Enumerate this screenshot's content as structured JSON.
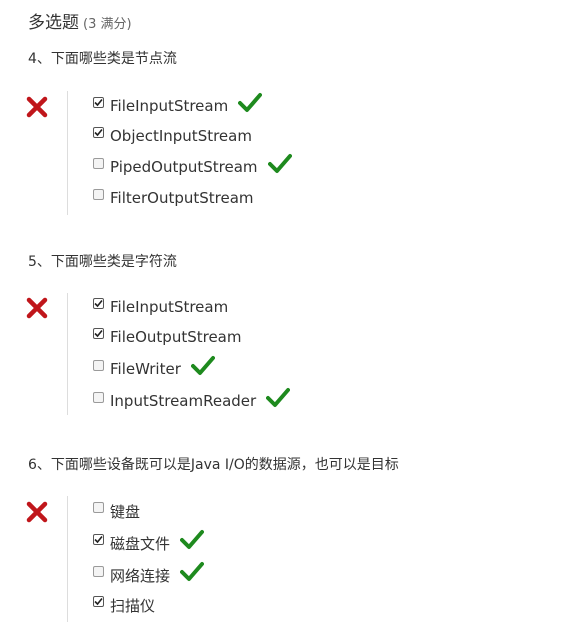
{
  "header": {
    "title": "多选题",
    "score": "(3 满分)"
  },
  "questions": [
    {
      "title": "4、下面哪些类是节点流",
      "options": [
        {
          "label": "FileInputStream",
          "checked": true,
          "correct": true
        },
        {
          "label": "ObjectInputStream",
          "checked": true,
          "correct": false
        },
        {
          "label": "PipedOutputStream",
          "checked": false,
          "correct": true
        },
        {
          "label": "FilterOutputStream",
          "checked": false,
          "correct": false
        }
      ]
    },
    {
      "title": "5、下面哪些类是字符流",
      "options": [
        {
          "label": "FileInputStream",
          "checked": true,
          "correct": false
        },
        {
          "label": "FileOutputStream",
          "checked": true,
          "correct": false
        },
        {
          "label": "FileWriter",
          "checked": false,
          "correct": true
        },
        {
          "label": "InputStreamReader",
          "checked": false,
          "correct": true
        }
      ]
    },
    {
      "title": "6、下面哪些设备既可以是Java I/O的数据源，也可以是目标",
      "options": [
        {
          "label": "键盘",
          "checked": false,
          "correct": false
        },
        {
          "label": "磁盘文件",
          "checked": true,
          "correct": true
        },
        {
          "label": "网络连接",
          "checked": false,
          "correct": true
        },
        {
          "label": "扫描仪",
          "checked": true,
          "correct": false
        }
      ]
    }
  ],
  "colors": {
    "wrong": "#c0161b",
    "correct": "#1e8a1e"
  }
}
